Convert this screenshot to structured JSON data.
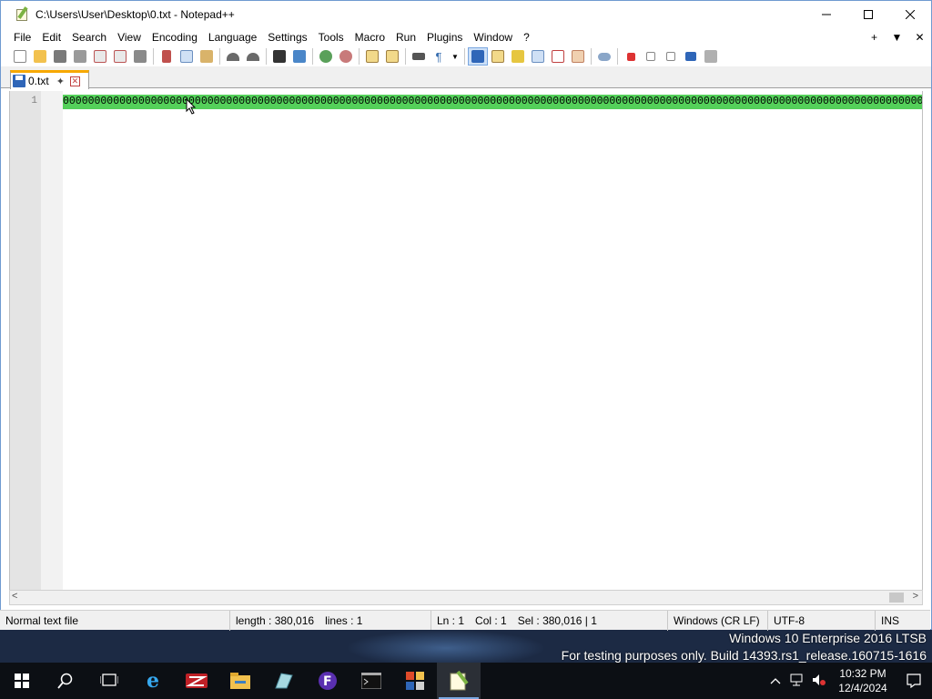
{
  "window": {
    "title": "C:\\Users\\User\\Desktop\\0.txt - Notepad++",
    "controls": [
      "minimize-icon",
      "maximize-icon",
      "close-icon"
    ]
  },
  "menu": {
    "items": [
      "File",
      "Edit",
      "Search",
      "View",
      "Encoding",
      "Language",
      "Settings",
      "Tools",
      "Macro",
      "Run",
      "Plugins",
      "Window",
      "?"
    ],
    "right": [
      "+",
      "▼",
      "✕"
    ]
  },
  "toolbar": {
    "buttons": [
      "new-file-icon",
      "open-file-icon",
      "save-icon",
      "save-all-icon",
      "close-icon",
      "close-all-icon",
      "print-icon",
      "cut-icon",
      "copy-icon",
      "paste-icon",
      "undo-icon",
      "redo-icon",
      "find-icon",
      "replace-icon",
      "zoom-in-icon",
      "zoom-out-icon",
      "sync-vertical-icon",
      "sync-horizontal-icon",
      "word-wrap-icon",
      "show-all-chars-icon",
      "indent-guide-icon",
      "doc-map-icon",
      "function-list-icon",
      "folder-workspace-icon",
      "monitor-icon",
      "record-macro-icon",
      "stop-record-icon",
      "play-macro-icon",
      "run-macro-multiple-icon",
      "save-macro-icon"
    ]
  },
  "tabs": [
    {
      "label": "0.txt"
    }
  ],
  "editor": {
    "line_number": "1",
    "line_text": "0000000000000000000000000000000000000000000000000000000000000000000000000000000000000000000000000000000000000000000000000000000000000000000000000000000000000000000000000000000000000000000000000000000000000000000000000000000000000000000000000000000000"
  },
  "status": {
    "file_type": "Normal text file",
    "length": "length : 380,016",
    "lines": "lines : 1",
    "ln": "Ln : 1",
    "col": "Col : 1",
    "sel": "Sel : 380,016 | 1",
    "eol": "Windows (CR LF)",
    "encoding": "UTF-8",
    "mode": "INS"
  },
  "desktop": {
    "watermark_line1": "Windows 10 Enterprise 2016 LTSB",
    "watermark_line2": "For testing purposes only. Build 14393.rs1_release.160715-1616"
  },
  "taskbar": {
    "time": "10:32 PM",
    "date": "12/4/2024",
    "apps": [
      "start-icon",
      "search-icon",
      "task-view-icon",
      "internet-explorer-icon",
      "filezilla-icon",
      "file-explorer-icon",
      "app-icon",
      "firefox-icon",
      "terminal-icon",
      "office-icon",
      "notepadpp-icon"
    ]
  },
  "colors": {
    "selection": "#54d05a",
    "tab_accent": "#f7a800",
    "taskbar": "#0c0f14"
  }
}
